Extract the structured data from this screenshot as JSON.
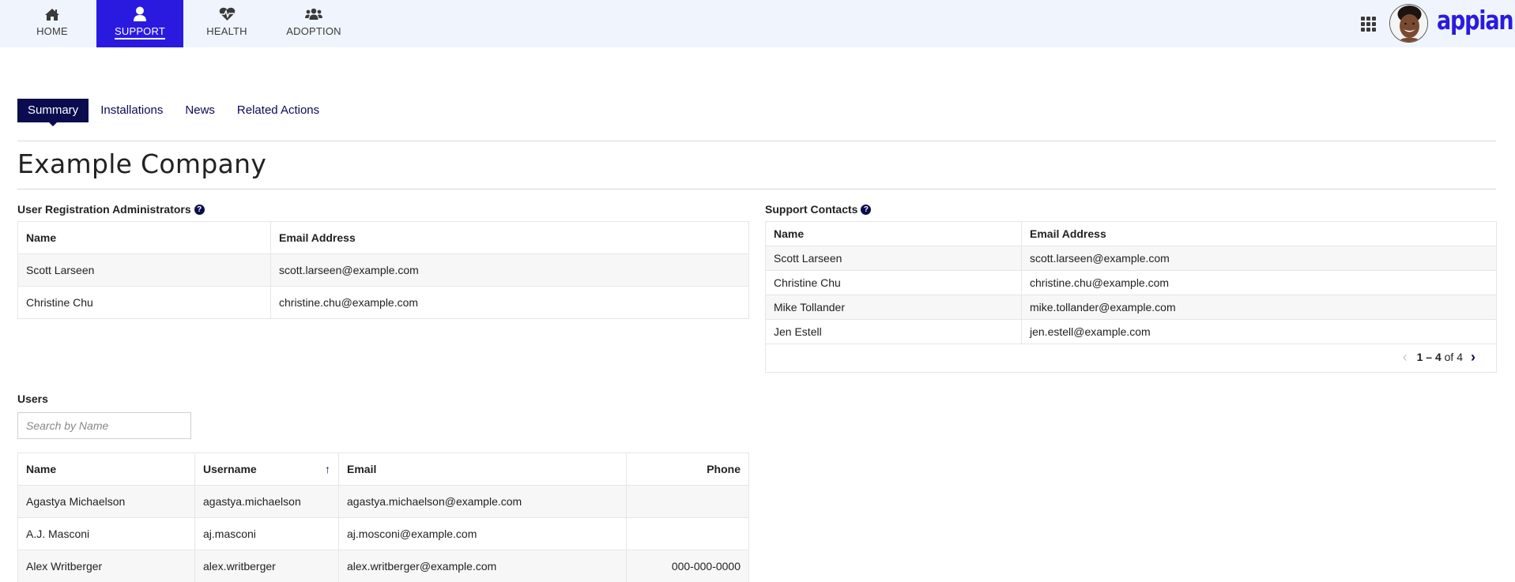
{
  "nav": {
    "items": [
      {
        "label": "HOME",
        "icon": "home-icon"
      },
      {
        "label": "SUPPORT",
        "icon": "user-icon",
        "active": true
      },
      {
        "label": "HEALTH",
        "icon": "heartbeat-icon"
      },
      {
        "label": "ADOPTION",
        "icon": "users-icon"
      }
    ],
    "brand": "appian",
    "accent_color": "#2a1ae0"
  },
  "tabs": [
    {
      "label": "Summary",
      "active": true
    },
    {
      "label": "Installations"
    },
    {
      "label": "News"
    },
    {
      "label": "Related Actions"
    }
  ],
  "page": {
    "title": "Example Company"
  },
  "admins": {
    "label": "User Registration Administrators",
    "columns": [
      "Name",
      "Email Address"
    ],
    "rows": [
      [
        "Scott Larseen",
        "scott.larseen@example.com"
      ],
      [
        "Christine Chu",
        "christine.chu@example.com"
      ]
    ]
  },
  "contacts": {
    "label": "Support Contacts",
    "columns": [
      "Name",
      "Email Address"
    ],
    "rows": [
      [
        "Scott Larseen",
        "scott.larseen@example.com"
      ],
      [
        "Christine Chu",
        "christine.chu@example.com"
      ],
      [
        "Mike Tollander",
        "mike.tollander@example.com"
      ],
      [
        "Jen Estell",
        "jen.estell@example.com"
      ]
    ],
    "pager": {
      "range": "1 – 4",
      "of_text": "of 4"
    }
  },
  "users": {
    "label": "Users",
    "search_placeholder": "Search by Name",
    "search_value": "",
    "columns": [
      "Name",
      "Username",
      "Email",
      "Phone"
    ],
    "sort_column": "Username",
    "sort_direction": "ascending",
    "rows": [
      [
        "Agastya Michaelson",
        "agastya.michaelson",
        "agastya.michaelson@example.com",
        ""
      ],
      [
        "A.J. Masconi",
        "aj.masconi",
        "aj.mosconi@example.com",
        ""
      ],
      [
        "Alex Writberger",
        "alex.writberger",
        "alex.writberger@example.com",
        "000-000-0000"
      ]
    ]
  }
}
